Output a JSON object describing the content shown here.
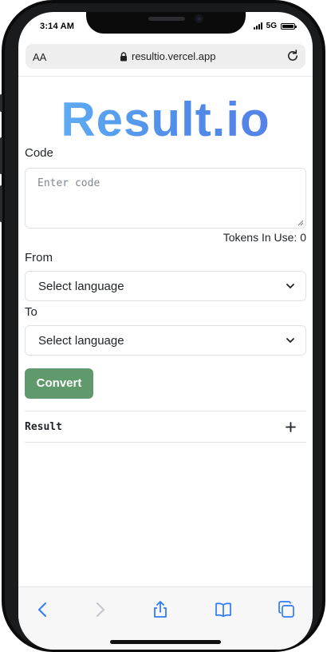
{
  "status_bar": {
    "time": "3:14 AM",
    "network": "5G"
  },
  "browser": {
    "aa_label": "AA",
    "url": "resultio.vercel.app"
  },
  "app": {
    "logo": "Result.io",
    "code_label": "Code",
    "code_placeholder": "Enter code",
    "tokens_text": "Tokens In Use: 0",
    "from_label": "From",
    "from_select": "Select language",
    "to_label": "To",
    "to_select": "Select language",
    "convert_button": "Convert",
    "result_label": "Result"
  },
  "toolbar": {
    "icons": [
      "back-icon",
      "forward-icon",
      "share-icon",
      "bookmarks-icon",
      "tabs-icon"
    ]
  },
  "colors": {
    "accent_green": "#609a6c",
    "logo_blue": "#4f8ae8",
    "ios_blue": "#2f7cf6"
  }
}
